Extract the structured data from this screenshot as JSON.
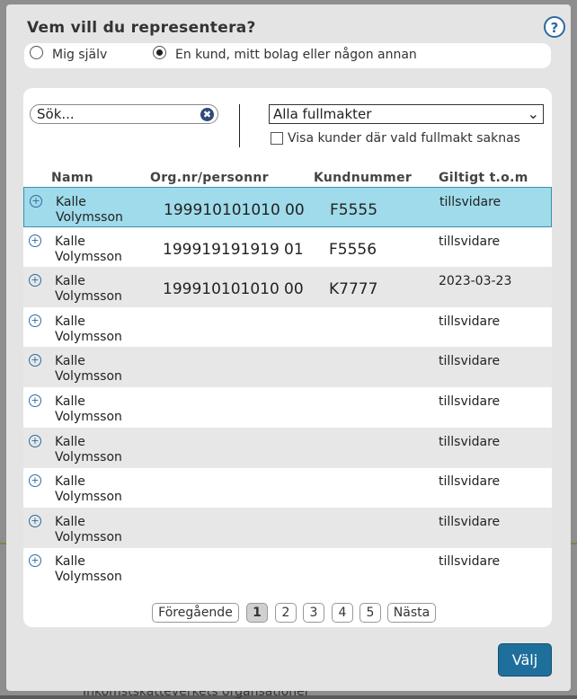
{
  "dialog": {
    "title": "Vem vill du representera?",
    "help_label": "?",
    "radio_options": [
      {
        "label": "Mig själv",
        "checked": false
      },
      {
        "label": "En kund, mitt bolag eller någon annan",
        "checked": true
      }
    ]
  },
  "filters": {
    "search_placeholder": "Sök...",
    "search_clear": "✖",
    "select_value": "Alla fullmakter",
    "checkbox_label": "Visa kunder där vald fullmakt saknas",
    "checkbox_checked": false
  },
  "table": {
    "headers": [
      "Namn",
      "Org.nr/personnr",
      "Kundnummer",
      "Giltigt t.o.m"
    ],
    "rows": [
      {
        "name1": "Kalle",
        "name2": "Volymsson",
        "orgnr": "199910101010",
        "suffix": "00",
        "kund": "F5555",
        "giltig": "tillsvidare",
        "selected": true
      },
      {
        "name1": "Kalle",
        "name2": "Volymsson",
        "orgnr": "199919191919",
        "suffix": "01",
        "kund": "F5556",
        "giltig": "tillsvidare",
        "selected": false
      },
      {
        "name1": "Kalle",
        "name2": "Volymsson",
        "orgnr": "199910101010",
        "suffix": "00",
        "kund": "K7777",
        "giltig": "2023-03-23",
        "selected": false
      },
      {
        "name1": "Kalle",
        "name2": "Volymsson",
        "orgnr": "",
        "suffix": "",
        "kund": "",
        "giltig": "tillsvidare",
        "selected": false
      },
      {
        "name1": "Kalle",
        "name2": "Volymsson",
        "orgnr": "",
        "suffix": "",
        "kund": "",
        "giltig": "tillsvidare",
        "selected": false
      },
      {
        "name1": "Kalle",
        "name2": "Volymsson",
        "orgnr": "",
        "suffix": "",
        "kund": "",
        "giltig": "tillsvidare",
        "selected": false
      },
      {
        "name1": "Kalle",
        "name2": "Volymsson",
        "orgnr": "",
        "suffix": "",
        "kund": "",
        "giltig": "tillsvidare",
        "selected": false
      },
      {
        "name1": "Kalle",
        "name2": "Volymsson",
        "orgnr": "",
        "suffix": "",
        "kund": "",
        "giltig": "tillsvidare",
        "selected": false
      },
      {
        "name1": "Kalle",
        "name2": "Volymsson",
        "orgnr": "",
        "suffix": "",
        "kund": "",
        "giltig": "tillsvidare",
        "selected": false
      },
      {
        "name1": "Kalle",
        "name2": "Volymsson",
        "orgnr": "",
        "suffix": "",
        "kund": "",
        "giltig": "tillsvidare",
        "selected": false
      }
    ]
  },
  "pagination": {
    "prev": "Föregående",
    "pages": [
      "1",
      "2",
      "3",
      "4",
      "5"
    ],
    "current": "1",
    "next": "Nästa"
  },
  "actions": {
    "choose": "Välj"
  },
  "background": {
    "bottom_text": "Inkomstskatteverkets organsationer"
  },
  "colors": {
    "accent": "#1f6f9c",
    "selected_row": "#9fdbea",
    "alt_row": "#e7e7e7",
    "dialog_bg": "#e4e4e4"
  }
}
